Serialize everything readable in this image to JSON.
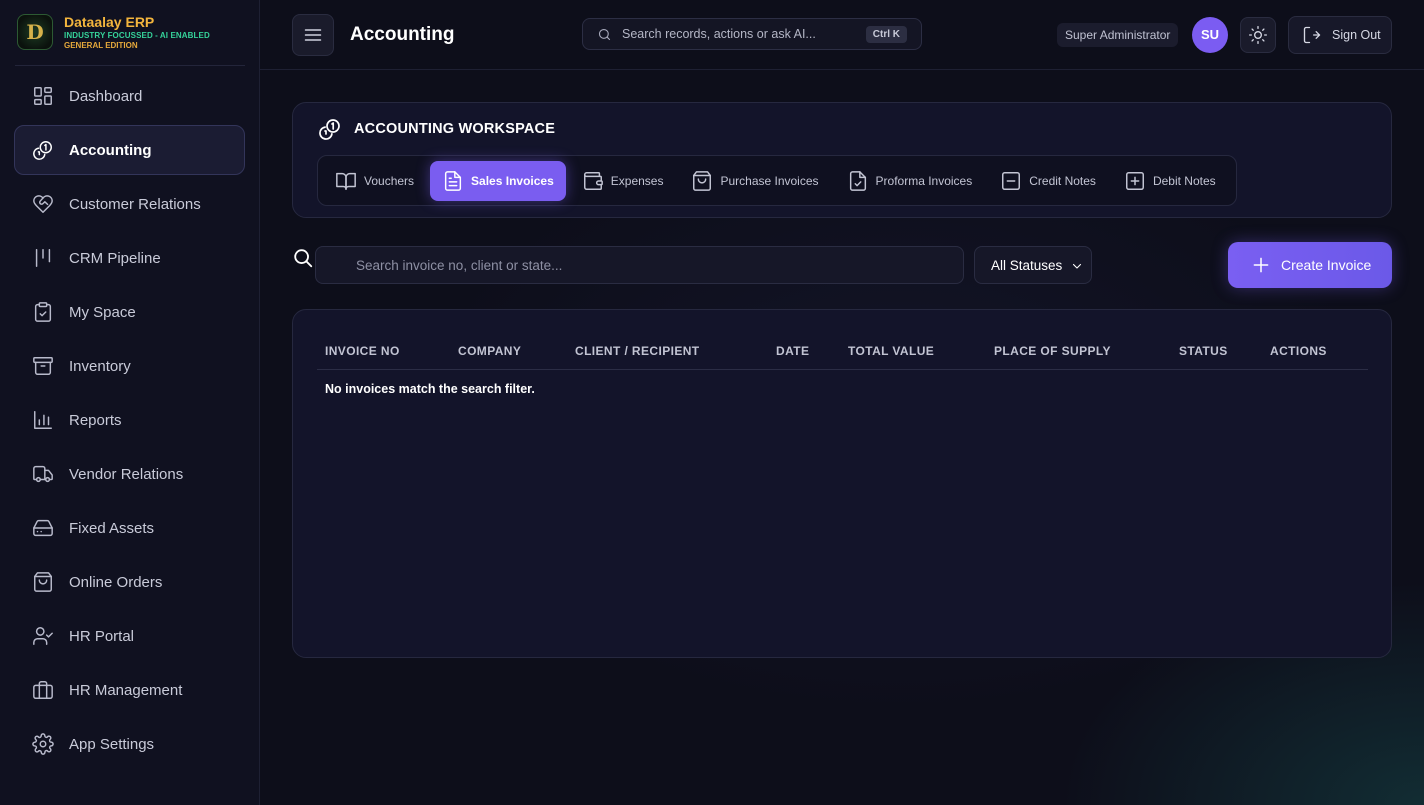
{
  "brand": {
    "title": "Dataalay ERP",
    "subtitle_1": "INDUSTRY FOCUSSED - AI ENABLED",
    "subtitle_2": "GENERAL EDITION",
    "logo_letter": "D"
  },
  "sidebar": {
    "items": [
      {
        "label": "Dashboard",
        "icon": "dashboard-grid-icon",
        "active": false
      },
      {
        "label": "Accounting",
        "icon": "coins-icon",
        "active": true
      },
      {
        "label": "Customer Relations",
        "icon": "heart-handshake-icon",
        "active": false
      },
      {
        "label": "CRM Pipeline",
        "icon": "pipeline-icon",
        "active": false
      },
      {
        "label": "My Space",
        "icon": "clipboard-check-icon",
        "active": false
      },
      {
        "label": "Inventory",
        "icon": "archive-box-icon",
        "active": false
      },
      {
        "label": "Reports",
        "icon": "bar-chart-icon",
        "active": false
      },
      {
        "label": "Vendor Relations",
        "icon": "truck-icon",
        "active": false
      },
      {
        "label": "Fixed Assets",
        "icon": "hard-drive-icon",
        "active": false
      },
      {
        "label": "Online Orders",
        "icon": "shopping-bag-icon",
        "active": false
      },
      {
        "label": "HR Portal",
        "icon": "user-check-icon",
        "active": false
      },
      {
        "label": "HR Management",
        "icon": "briefcase-icon",
        "active": false
      },
      {
        "label": "App Settings",
        "icon": "gear-icon",
        "active": false
      }
    ]
  },
  "header": {
    "title": "Accounting",
    "search_placeholder": "Search records, actions or ask AI...",
    "search_shortcut": "Ctrl K",
    "role": "Super Administrator",
    "avatar_initials": "SU",
    "signout_label": "Sign Out"
  },
  "workspace": {
    "title": "ACCOUNTING WORKSPACE",
    "tabs": [
      {
        "label": "Vouchers",
        "icon": "book-open-icon",
        "active": false
      },
      {
        "label": "Sales Invoices",
        "icon": "file-text-icon",
        "active": true
      },
      {
        "label": "Expenses",
        "icon": "wallet-icon",
        "active": false
      },
      {
        "label": "Purchase Invoices",
        "icon": "shopping-bag-icon",
        "active": false
      },
      {
        "label": "Proforma Invoices",
        "icon": "file-check-icon",
        "active": false
      },
      {
        "label": "Credit Notes",
        "icon": "minus-square-icon",
        "active": false
      },
      {
        "label": "Debit Notes",
        "icon": "plus-square-icon",
        "active": false
      }
    ]
  },
  "filters": {
    "search_placeholder": "Search invoice no, client or state...",
    "status_selected": "All Statuses",
    "create_label": "Create Invoice"
  },
  "table": {
    "columns": [
      "INVOICE NO",
      "COMPANY",
      "CLIENT / RECIPIENT",
      "DATE",
      "TOTAL VALUE",
      "PLACE OF SUPPLY",
      "STATUS",
      "ACTIONS"
    ],
    "empty_message": "No invoices match the search filter."
  },
  "colors": {
    "accent": "#7a5df0",
    "background": "#0d0e1a",
    "brand_gold": "#f3b53d",
    "brand_green": "#35d39a"
  }
}
